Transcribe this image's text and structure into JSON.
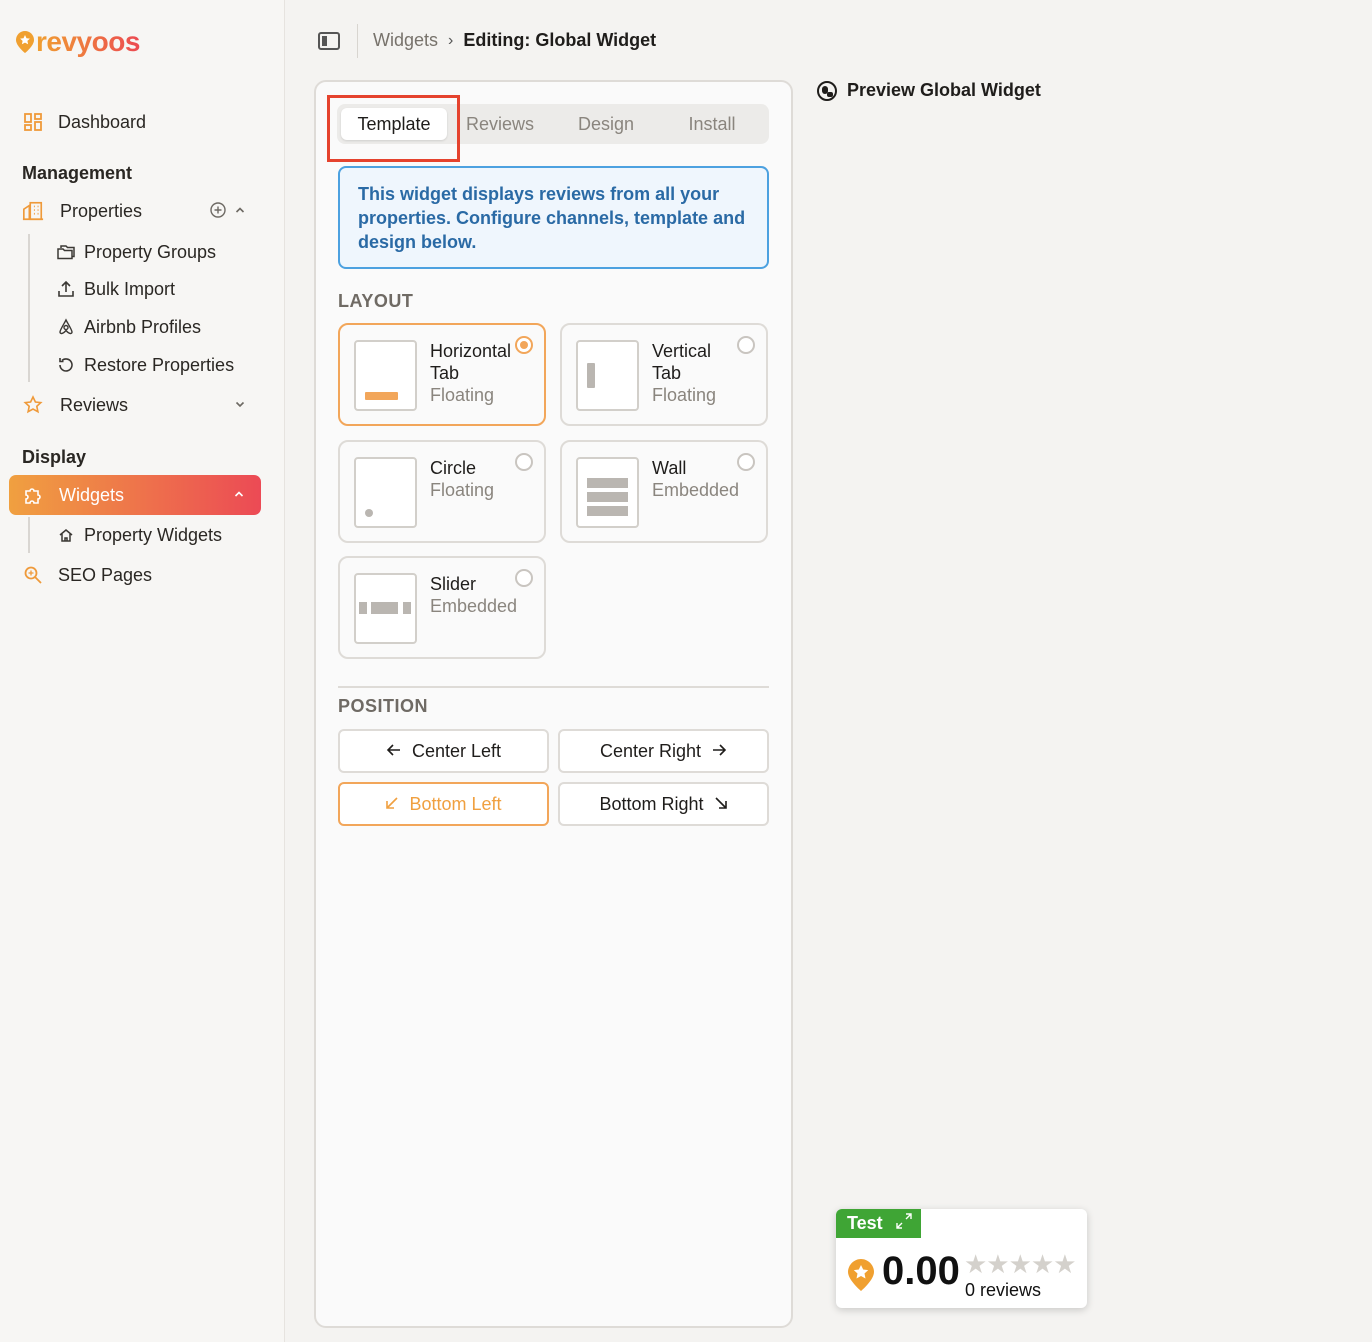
{
  "logo": {
    "text": "revyoos"
  },
  "sidebar": {
    "dashboard": "Dashboard",
    "management_label": "Management",
    "properties": "Properties",
    "property_groups": "Property Groups",
    "bulk_import": "Bulk Import",
    "airbnb_profiles": "Airbnb Profiles",
    "restore_properties": "Restore Properties",
    "reviews": "Reviews",
    "display_label": "Display",
    "widgets": "Widgets",
    "property_widgets": "Property Widgets",
    "seo_pages": "SEO Pages"
  },
  "breadcrumb": {
    "parent": "Widgets",
    "current": "Editing: Global Widget"
  },
  "tabs": [
    "Template",
    "Reviews",
    "Design",
    "Install"
  ],
  "info": "This widget displays reviews from all your properties. Configure channels, template and design below.",
  "layout": {
    "label": "LAYOUT",
    "options": [
      {
        "title": "Horizontal Tab",
        "title1": "Horizontal",
        "title2": "Tab",
        "sub": "Floating",
        "selected": true
      },
      {
        "title": "Vertical Tab",
        "title1": "Vertical",
        "title2": "Tab",
        "sub": "Floating",
        "selected": false
      },
      {
        "title": "Circle",
        "title1": "Circle",
        "sub": "Floating",
        "selected": false
      },
      {
        "title": "Wall",
        "title1": "Wall",
        "sub": "Embedded",
        "selected": false
      },
      {
        "title": "Slider",
        "title1": "Slider",
        "sub": "Embedded",
        "selected": false
      }
    ]
  },
  "position": {
    "label": "POSITION",
    "center_left": "Center Left",
    "center_right": "Center Right",
    "bottom_left": "Bottom Left",
    "bottom_right": "Bottom Right",
    "selected": "Bottom Left"
  },
  "preview": {
    "title": "Preview Global Widget"
  },
  "widget": {
    "tag": "Test",
    "score": "0.00",
    "stars": "★★★★★",
    "count": "0 reviews"
  },
  "colors": {
    "accent": "#f0a040",
    "brand_red": "#ec4a55",
    "info_blue": "#2a6aa5",
    "tag_green": "#3fa535"
  }
}
